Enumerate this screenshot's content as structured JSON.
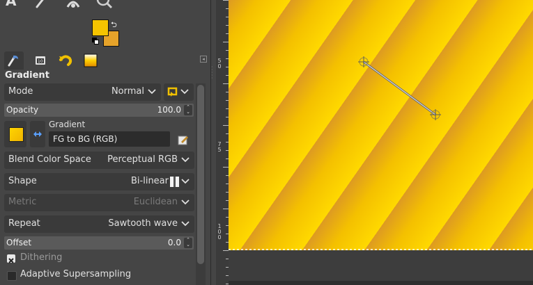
{
  "panel": {
    "title": "Gradient",
    "mode": {
      "label": "Mode",
      "value": "Normal"
    },
    "opacity": {
      "label": "Opacity",
      "value": "100.0"
    },
    "gradient": {
      "label": "Gradient",
      "name": "FG to BG (RGB)"
    },
    "blend_color_space": {
      "label": "Blend Color Space",
      "value": "Perceptual RGB"
    },
    "shape": {
      "label": "Shape",
      "value": "Bi-linear"
    },
    "metric": {
      "label": "Metric",
      "value": "Euclidean"
    },
    "repeat": {
      "label": "Repeat",
      "value": "Sawtooth wave"
    },
    "offset": {
      "label": "Offset",
      "value": "0.0"
    },
    "dithering": {
      "label": "Dithering",
      "checked": true
    },
    "adaptive": {
      "label": "Adaptive Supersampling",
      "checked": false
    }
  },
  "colors": {
    "foreground": "#f5c400",
    "background": "#e6a32a"
  },
  "tabs": [
    {
      "icon": "tool-options-icon",
      "active": true
    },
    {
      "icon": "device-status-icon",
      "active": false
    },
    {
      "icon": "undo-history-icon",
      "active": false
    },
    {
      "icon": "gradients-icon",
      "active": false
    }
  ],
  "ruler": {
    "labels": [
      "5 0",
      "7 5",
      "1 0 0"
    ]
  },
  "canvas": {
    "fill": "sawtooth bi-linear gradient",
    "gradient_line": true
  }
}
